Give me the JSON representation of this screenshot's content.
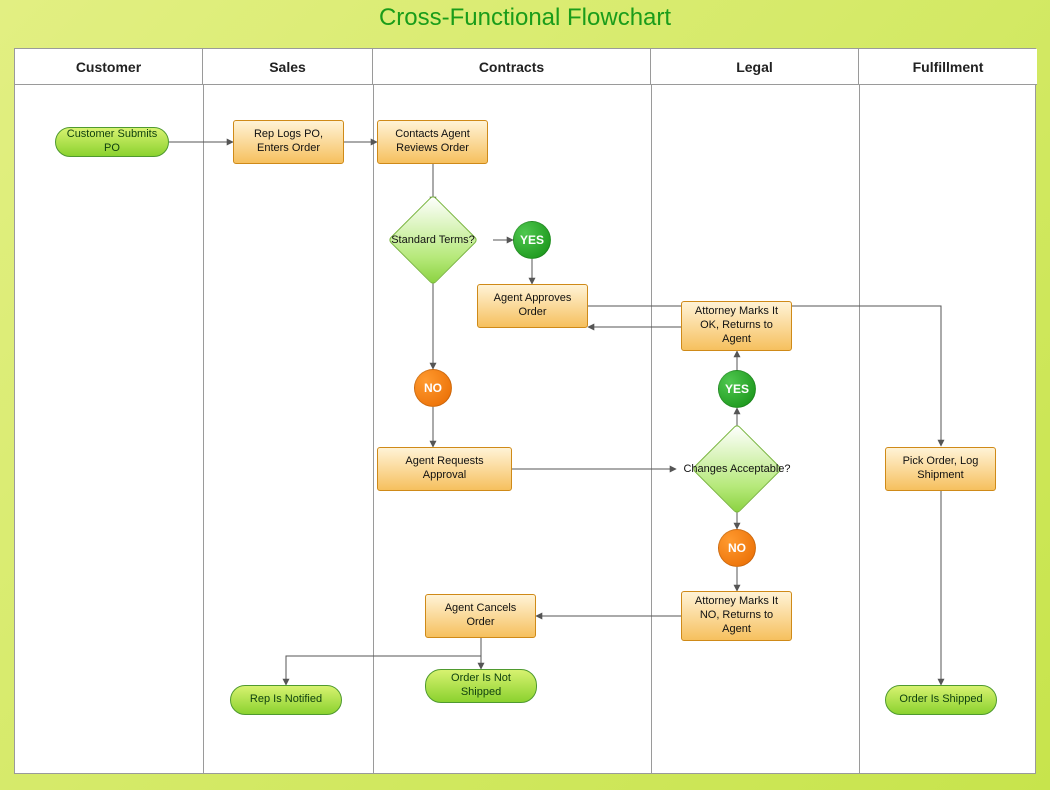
{
  "title": "Cross-Functional Flowchart",
  "lanes": [
    {
      "label": "Customer"
    },
    {
      "label": "Sales"
    },
    {
      "label": "Contracts"
    },
    {
      "label": "Legal"
    },
    {
      "label": "Fulfillment"
    }
  ],
  "nodes": {
    "customer_submits_po": "Customer Submits PO",
    "rep_logs_po": "Rep Logs PO, Enters Order",
    "contacts_agent_reviews": "Contacts Agent Reviews Order",
    "standard_terms": "Standard Terms?",
    "yes1": "YES",
    "agent_approves": "Agent Approves Order",
    "attorney_ok": "Attorney Marks It OK, Returns to Agent",
    "yes2": "YES",
    "no1": "NO",
    "agent_requests_approval": "Agent Requests Approval",
    "changes_acceptable": "Changes Acceptable?",
    "pick_order": "Pick Order, Log Shipment",
    "no2": "NO",
    "attorney_no": "Attorney Marks It NO, Returns to Agent",
    "agent_cancels": "Agent Cancels Order",
    "rep_notified": "Rep Is Notified",
    "order_not_shipped": "Order Is Not Shipped",
    "order_shipped": "Order Is Shipped"
  }
}
